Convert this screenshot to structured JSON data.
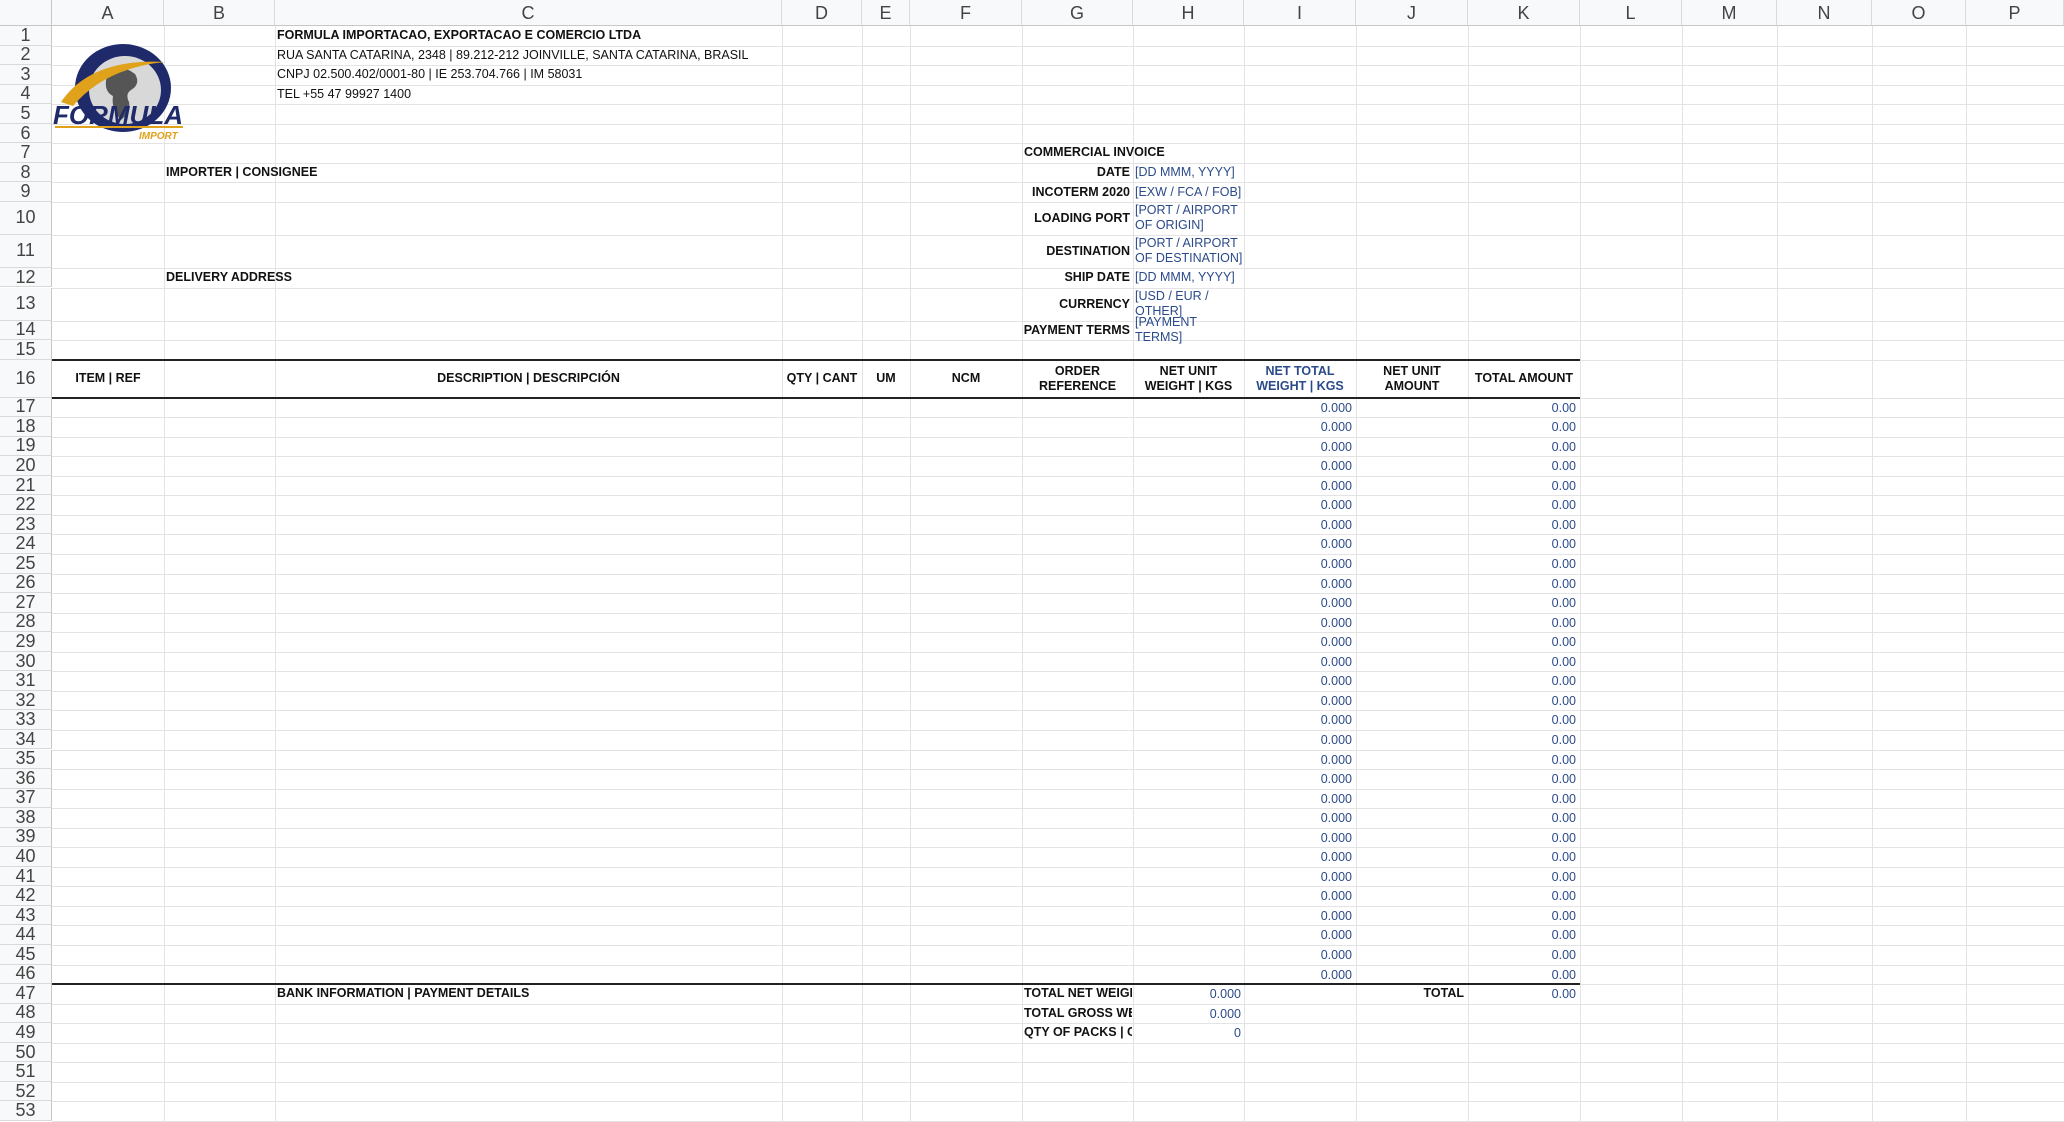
{
  "columns": [
    "A",
    "B",
    "C",
    "D",
    "E",
    "F",
    "G",
    "H",
    "I",
    "J",
    "K",
    "L",
    "M",
    "N",
    "O",
    "P"
  ],
  "rows": [
    "1",
    "2",
    "3",
    "4",
    "5",
    "6",
    "7",
    "8",
    "9",
    "10",
    "11",
    "12",
    "13",
    "14",
    "15",
    "16",
    "17",
    "18",
    "19",
    "20",
    "21",
    "22",
    "23",
    "24",
    "25",
    "26",
    "27",
    "28",
    "29",
    "30",
    "31",
    "32",
    "33",
    "34",
    "35",
    "36",
    "37",
    "38",
    "39",
    "40",
    "41",
    "42",
    "43",
    "44",
    "45",
    "46",
    "47",
    "48",
    "49",
    "50",
    "51",
    "52",
    "53"
  ],
  "company": {
    "name": "FORMULA IMPORTACAO, EXPORTACAO E COMERCIO LTDA",
    "address": "RUA SANTA CATARINA, 2348 | 89.212-212 JOINVILLE, SANTA CATARINA, BRASIL",
    "ids": "CNPJ 02.500.402/0001-80 | IE 253.704.766 | IM 58031",
    "tel": "TEL +55 47 99927 1400",
    "logo_text": "FORMULA",
    "logo_sub": "IMPORT"
  },
  "invoice": {
    "title": "COMMERCIAL INVOICE",
    "fields": [
      {
        "label": "DATE",
        "value": "[DD MMM, YYYY]"
      },
      {
        "label": "INCOTERM 2020",
        "value": "[EXW / FCA / FOB]"
      },
      {
        "label": "LOADING PORT",
        "value": "[PORT / AIRPORT OF ORIGIN]"
      },
      {
        "label": "DESTINATION",
        "value": "[PORT / AIRPORT OF DESTINATION]"
      },
      {
        "label": "SHIP DATE",
        "value": "[DD MMM, YYYY]"
      },
      {
        "label": "CURRENCY",
        "value": "[USD / EUR / OTHER]"
      },
      {
        "label": "PAYMENT TERMS",
        "value": "[PAYMENT TERMS]"
      }
    ],
    "importer_label": "IMPORTER | CONSIGNEE",
    "delivery_label": "DELIVERY ADDRESS"
  },
  "table": {
    "headers": [
      "ITEM | REF",
      "DESCRIPTION | DESCRIPCIÓN",
      "QTY | CANT",
      "UM",
      "NCM",
      "ORDER REFERENCE",
      "NET UNIT WEIGHT | KGS",
      "NET TOTAL WEIGHT | KGS",
      "NET UNIT AMOUNT",
      "TOTAL AMOUNT"
    ],
    "row_weight": "0.000",
    "row_amount": "0.00"
  },
  "footer": {
    "bank_label": "BANK INFORMATION | PAYMENT DETAILS",
    "total_net_weight_label": "TOTAL NET WEIGHT",
    "total_net_weight": "0.000",
    "total_gross_weight_label": "TOTAL GROSS WEIGHT",
    "total_gross_weight": "0.000",
    "qty_packs_label": "QTY OF PACKS | CA",
    "qty_packs": "0",
    "total_label": "TOTAL",
    "total_value": "0.00"
  }
}
